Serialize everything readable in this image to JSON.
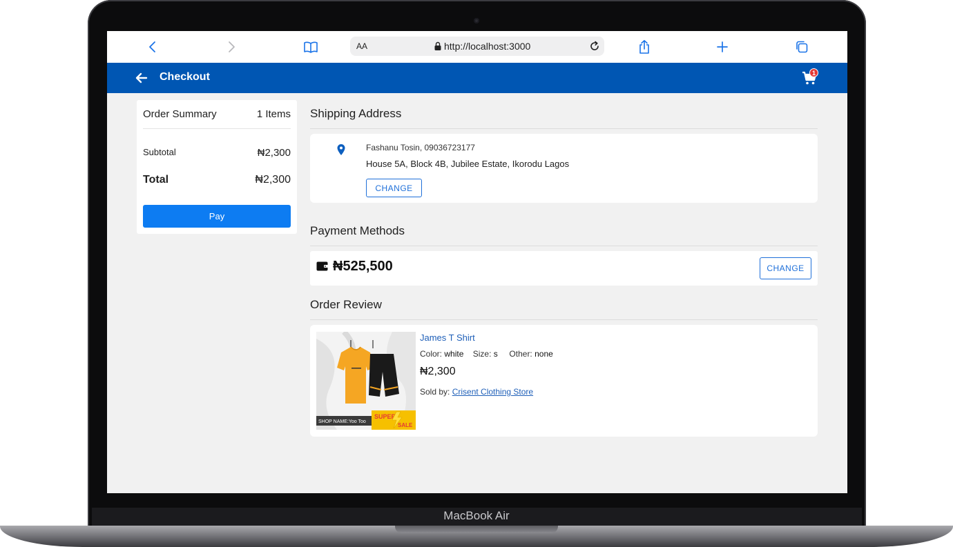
{
  "device": {
    "label": "MacBook Air"
  },
  "browser": {
    "text_size_label": "AA",
    "url": "http://localhost:3000",
    "icons": [
      "back-icon",
      "forward-icon",
      "bookmarks-icon",
      "lock-icon",
      "reload-icon",
      "share-icon",
      "new-tab-icon",
      "tabs-icon"
    ]
  },
  "header": {
    "title": "Checkout",
    "cart_count": "1",
    "brand_color": "#0056b3"
  },
  "summary": {
    "title": "Order Summary",
    "items_count": "1 Items",
    "subtotal_label": "Subtotal",
    "subtotal_value": "₦2,300",
    "total_label": "Total",
    "total_value": "₦2,300",
    "pay_label": "Pay",
    "pay_color": "#0d7cf2"
  },
  "shipping": {
    "title": "Shipping Address",
    "name_phone": "Fashanu Tosin, 09036723177",
    "address": "House 5A, Block 4B, Jubilee Estate, Ikorodu Lagos",
    "change_label": "CHANGE"
  },
  "payment": {
    "title": "Payment Methods",
    "wallet_balance": "₦525,500",
    "change_label": "CHANGE"
  },
  "review": {
    "title": "Order Review",
    "product": {
      "name": "James T Shirt",
      "color_label": "Color:",
      "color_value": "white",
      "size_label": "Size:",
      "size_value": "s",
      "other_label": "Other:",
      "other_value": "none",
      "price": "₦2,300",
      "sold_by_label": "Sold by:",
      "seller": "Crisent Clothing Store",
      "image_banner_text": "SHOP NAME:Yoo Too",
      "image_badge_top": "SUPER",
      "image_badge_bottom": "SALE"
    }
  }
}
